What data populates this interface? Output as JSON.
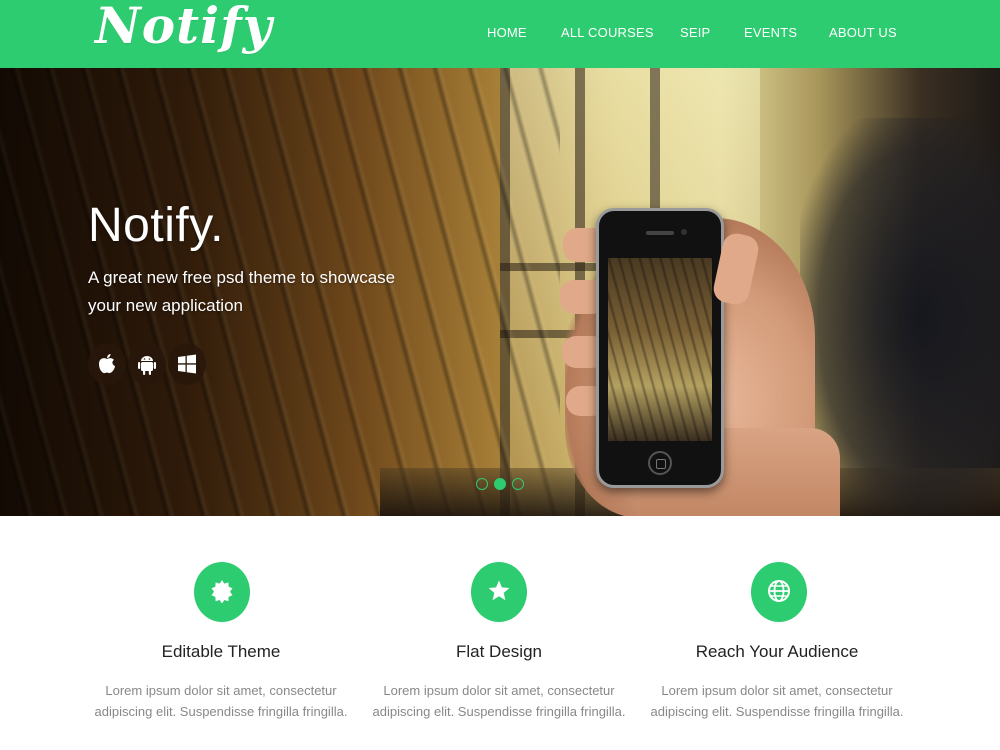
{
  "brand": {
    "logo_text": "Notify",
    "accent_color": "#2ecc71"
  },
  "nav": {
    "items": [
      {
        "label": "HOME"
      },
      {
        "label": "ALL COURSES"
      },
      {
        "label": "SEIP"
      },
      {
        "label": "EVENTS"
      },
      {
        "label": "ABOUT US"
      }
    ]
  },
  "hero": {
    "title": "Notify.",
    "subtitle": "A great new free psd theme to showcase your new application",
    "store_icons": [
      "apple-icon",
      "android-icon",
      "windows-icon"
    ],
    "slider": {
      "count": 3,
      "active_index": 1
    }
  },
  "features": [
    {
      "icon": "badge-icon",
      "title": "Editable Theme",
      "text": "Lorem ipsum dolor sit amet, consectetur adipiscing elit. Suspendisse fringilla fringilla."
    },
    {
      "icon": "star-icon",
      "title": "Flat Design",
      "text": "Lorem ipsum dolor sit amet, consectetur adipiscing elit. Suspendisse fringilla fringilla."
    },
    {
      "icon": "globe-icon",
      "title": "Reach Your Audience",
      "text": "Lorem ipsum dolor sit amet, consectetur adipiscing elit. Suspendisse fringilla fringilla."
    }
  ]
}
